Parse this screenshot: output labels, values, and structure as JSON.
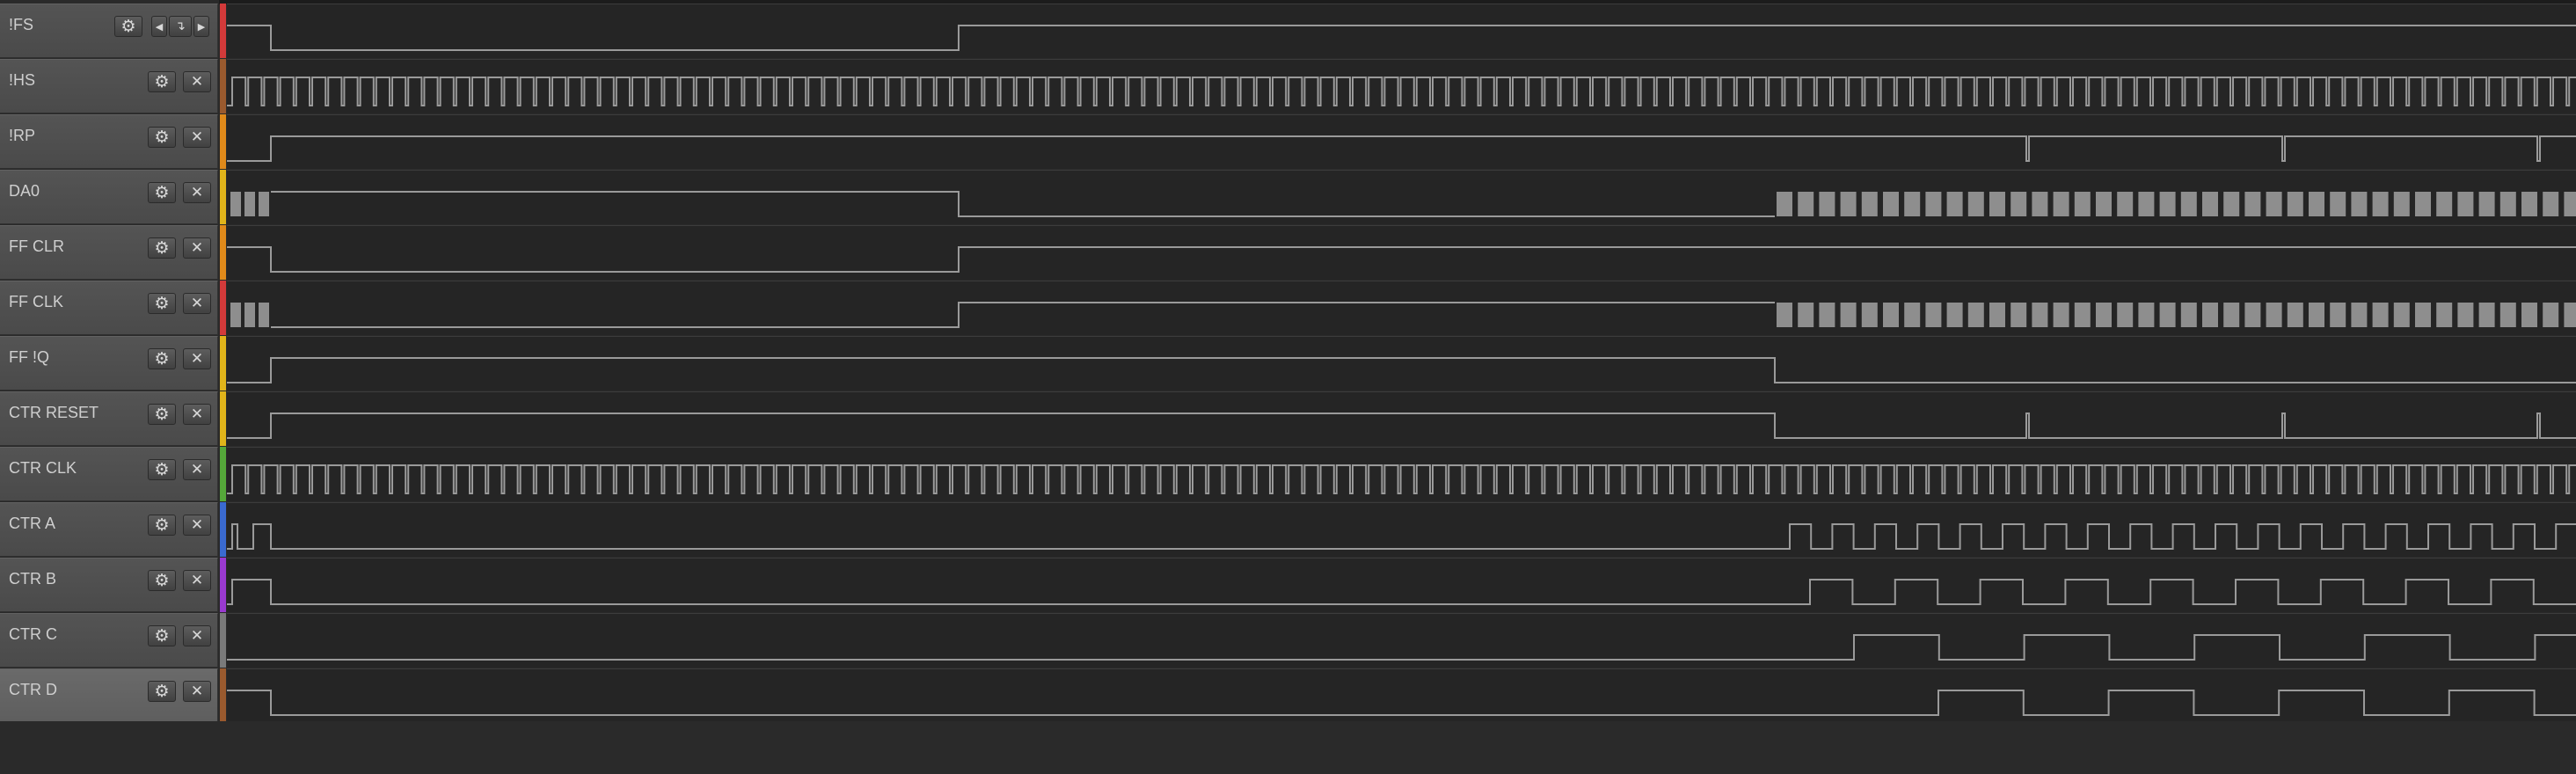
{
  "channels": [
    {
      "name": "!FS",
      "color": "#d33a3a",
      "has_nav": true
    },
    {
      "name": "!HS",
      "color": "#9a5a2e"
    },
    {
      "name": "!RP",
      "color": "#e08a1a"
    },
    {
      "name": "DA0",
      "color": "#e0b41a"
    },
    {
      "name": "FF CLR",
      "color": "#e08a1a"
    },
    {
      "name": "FF CLK",
      "color": "#d33a3a"
    },
    {
      "name": "FF !Q",
      "color": "#e0b41a"
    },
    {
      "name": "CTR RESET",
      "color": "#e0b41a"
    },
    {
      "name": "CTR CLK",
      "color": "#55a83a"
    },
    {
      "name": "CTR A",
      "color": "#3a6ad0"
    },
    {
      "name": "CTR B",
      "color": "#9a3ad0"
    },
    {
      "name": "CTR C",
      "color": "#7a7a7a"
    },
    {
      "name": "CTR D",
      "color": "#9a5a2e",
      "selected": true
    }
  ],
  "icons": {
    "gear": "⚙",
    "close": "✕",
    "nav_left": "◀",
    "nav_edge": "↴",
    "nav_right": "▶"
  },
  "colors": {
    "wave": "#9a9a9a",
    "wave_bright": "#b5b5b5",
    "burst_fill": "#8e8e8e"
  }
}
